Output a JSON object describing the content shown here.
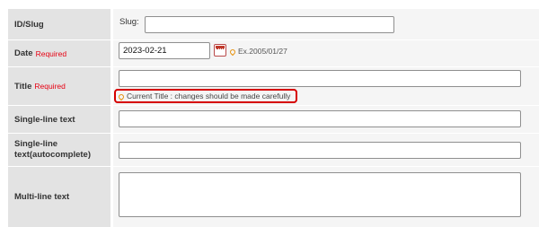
{
  "rows": {
    "slug": {
      "label": "ID/Slug",
      "prefix": "Slug:",
      "value": ""
    },
    "date": {
      "label": "Date",
      "required": "Required",
      "value": "2023-02-21",
      "example": "Ex.2005/01/27"
    },
    "title": {
      "label": "Title",
      "required": "Required",
      "value": "",
      "note": "Current Title : changes should be made carefully"
    },
    "single": {
      "label": "Single-line text",
      "value": ""
    },
    "auto": {
      "label": "Single-line text(autocomplete)",
      "value": ""
    },
    "multi": {
      "label": "Multi-line text",
      "value": ""
    }
  },
  "colors": {
    "required": "#e60012",
    "highlight_border": "#d60000",
    "label_bg": "#e3e3e3",
    "value_bg": "#f5f5f5"
  },
  "icons": [
    "calendar-icon",
    "pin-icon"
  ]
}
